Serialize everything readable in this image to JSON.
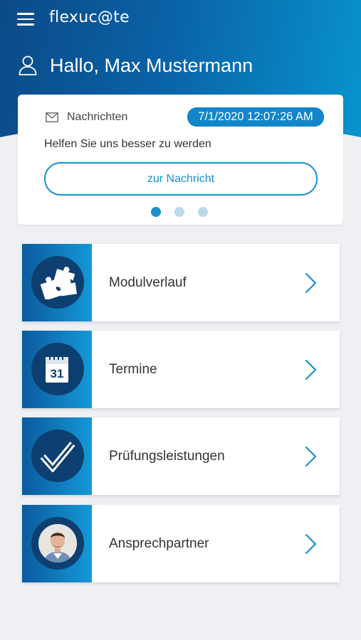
{
  "header": {
    "app_name": "flexuc@te",
    "greeting": "Hallo, Max Mustermann"
  },
  "messages": {
    "label": "Nachrichten",
    "timestamp": "7/1/2020 12:07:26 AM",
    "text": "Helfen Sie uns besser zu werden",
    "button_label": "zur Nachricht",
    "carousel_pages": 3,
    "active_page": 1
  },
  "menu": {
    "items": [
      {
        "label": "Modulverlauf",
        "icon": "puzzle-icon"
      },
      {
        "label": "Termine",
        "icon": "calendar-icon",
        "icon_text": "31"
      },
      {
        "label": "Prüfungsleistungen",
        "icon": "checkmark-icon"
      },
      {
        "label": "Ansprechpartner",
        "icon": "contact-avatar"
      }
    ]
  },
  "colors": {
    "header_dark": "#0b4a87",
    "header_light": "#0894cd",
    "accent": "#1a8fcf",
    "icon_circle": "#0d3f70",
    "background": "#eef0f3"
  }
}
